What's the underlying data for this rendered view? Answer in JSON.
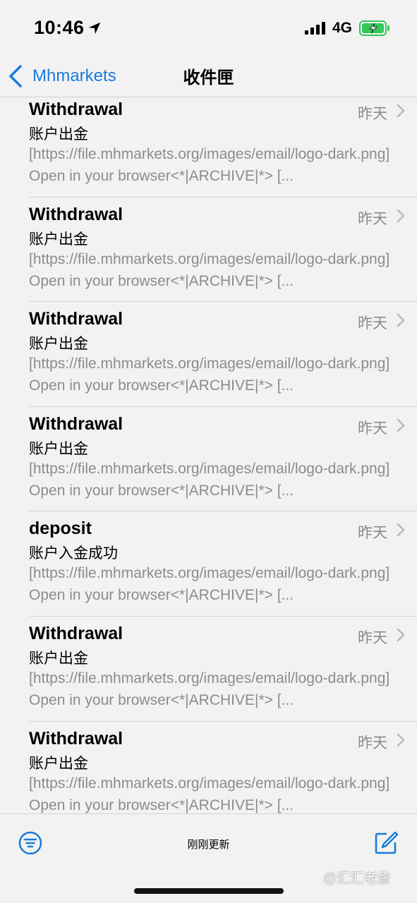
{
  "status": {
    "time": "10:46",
    "network": "4G"
  },
  "nav": {
    "back_label": "Mhmarkets",
    "title": "收件匣"
  },
  "messages": [
    {
      "sender": "Withdrawal",
      "date": "昨天",
      "subject": "账户出金",
      "preview": "[https://file.mhmarkets.org/images/email/logo-dark.png] Open in your browser<*|ARCHIVE|*> [..."
    },
    {
      "sender": "Withdrawal",
      "date": "昨天",
      "subject": "账户出金",
      "preview": "[https://file.mhmarkets.org/images/email/logo-dark.png] Open in your browser<*|ARCHIVE|*> [..."
    },
    {
      "sender": "Withdrawal",
      "date": "昨天",
      "subject": "账户出金",
      "preview": "[https://file.mhmarkets.org/images/email/logo-dark.png] Open in your browser<*|ARCHIVE|*> [..."
    },
    {
      "sender": "Withdrawal",
      "date": "昨天",
      "subject": "账户出金",
      "preview": "[https://file.mhmarkets.org/images/email/logo-dark.png] Open in your browser<*|ARCHIVE|*> [..."
    },
    {
      "sender": "deposit",
      "date": "昨天",
      "subject": "账户入金成功",
      "preview": "[https://file.mhmarkets.org/images/email/logo-dark.png] Open in your browser<*|ARCHIVE|*> [..."
    },
    {
      "sender": "Withdrawal",
      "date": "昨天",
      "subject": "账户出金",
      "preview": "[https://file.mhmarkets.org/images/email/logo-dark.png] Open in your browser<*|ARCHIVE|*> [..."
    },
    {
      "sender": "Withdrawal",
      "date": "昨天",
      "subject": "账户出金",
      "preview": "[https://file.mhmarkets.org/images/email/logo-dark.png] Open in your browser<*|ARCHIVE|*> [..."
    }
  ],
  "toolbar": {
    "status": "刚刚更新"
  },
  "watermark": "@汇汇老詹",
  "colors": {
    "accent": "#1a7bd8",
    "battery": "#34c759"
  },
  "icons": [
    "location-arrow-icon",
    "signal-icon",
    "battery-icon",
    "chevron-left-icon",
    "chevron-right-icon",
    "filter-icon",
    "compose-icon"
  ]
}
